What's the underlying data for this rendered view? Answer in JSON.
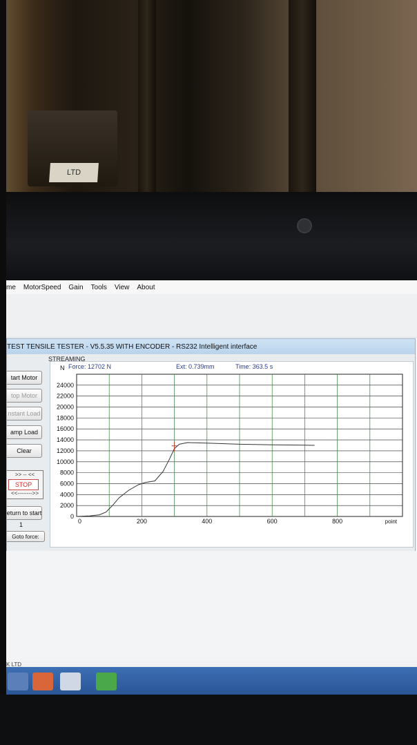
{
  "photo": {
    "tag_text": "LTD"
  },
  "menu": {
    "items": [
      "me",
      "MotorSpeed",
      "Gain",
      "Tools",
      "View",
      "About"
    ]
  },
  "window": {
    "title": "TEST TENSILE TESTER - V5.5.35 WITH ENCODER - RS232 Intelligent interface",
    "streaming_label": "STREAMING"
  },
  "buttons": {
    "start_motor": "tart Motor",
    "stop_motor": "top Motor",
    "constant_load": "nstant Load",
    "ramp_load": "amp Load",
    "clear": "Clear",
    "arrows_top": ">> -- <<",
    "stop": "STOP",
    "arrows_bottom": "<<-------->>",
    "return_to_start": "eturn to start",
    "count": "1",
    "goto_force": "Goto force:"
  },
  "readouts": {
    "force": "Force: 12702 N",
    "ext": "Ext: 0.739mm",
    "time": "Time: 363.5 s"
  },
  "colors": {
    "curve": "#333333",
    "curve_peak": "#c0392b",
    "grid_vertical": "#2e7d32",
    "grid_horizontal": "#222222",
    "readout_text": "#2b3a8f",
    "taskbar": "#2f5e9f"
  },
  "chart_data": {
    "type": "line",
    "ylabel": "N",
    "xlabel": "point",
    "xlim": [
      0,
      1000
    ],
    "ylim": [
      0,
      26000
    ],
    "x_ticks": [
      0,
      200,
      400,
      600,
      800
    ],
    "y_ticks": [
      0,
      2000,
      4000,
      6000,
      8000,
      10000,
      12000,
      14000,
      16000,
      18000,
      20000,
      22000,
      24000
    ],
    "grid": true,
    "series": [
      {
        "x": [
          0,
          40,
          70,
          90,
          110,
          130,
          160,
          190,
          210,
          240,
          265,
          285,
          300,
          315,
          340,
          400,
          500,
          600,
          680,
          730
        ],
        "y": [
          0,
          100,
          300,
          800,
          2000,
          3400,
          4800,
          5800,
          6200,
          6500,
          8200,
          10500,
          12400,
          13200,
          13500,
          13400,
          13200,
          13100,
          13050,
          13000
        ]
      }
    ]
  },
  "taskbar": {
    "status_text": "K LTD"
  }
}
